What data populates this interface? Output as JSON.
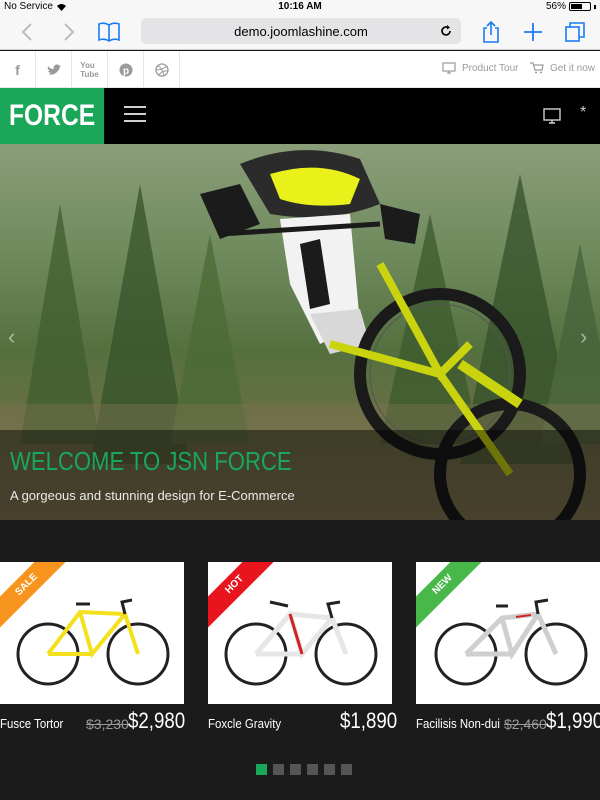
{
  "status": {
    "carrier": "No Service",
    "time": "10:16 AM",
    "battery": "56%",
    "battery_level": 0.56
  },
  "safari": {
    "url": "demo.joomlashine.com"
  },
  "topbar": {
    "social": [
      "facebook-icon",
      "twitter-icon",
      "youtube-icon",
      "pinterest-icon",
      "dribbble-icon"
    ],
    "product_tour": "Product Tour",
    "get_it_now": "Get it now"
  },
  "header": {
    "logo": "FORCE",
    "accent": "#1aa75a"
  },
  "hero": {
    "title": "WELCOME TO JSN FORCE",
    "subtitle": "A gorgeous and stunning design for E-Commerce"
  },
  "products": [
    {
      "badge": "SALE",
      "badge_color": "#f7941d",
      "name": "Fusce Tortor",
      "old_price": "$3,230",
      "price": "$2,980",
      "frame_color": "#f2e11c"
    },
    {
      "badge": "HOT",
      "badge_color": "#e8141e",
      "name": "Foxcle Gravity",
      "old_price": "",
      "price": "$1,890",
      "frame_color": "#d42020"
    },
    {
      "badge": "NEW",
      "badge_color": "#49b84a",
      "name": "Facilisis Non-dui",
      "old_price": "$2,460",
      "price": "$1,990",
      "frame_color": "#cfcfcf"
    }
  ],
  "pagination": {
    "count": 6,
    "active": 1
  }
}
